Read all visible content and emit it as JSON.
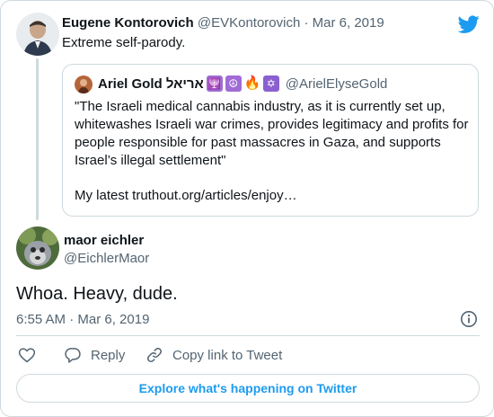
{
  "parent_tweet": {
    "author_name": "Eugene Kontorovich",
    "author_handle": "@EVKontorovich",
    "separator": "·",
    "date": "Mar 6, 2019",
    "text": "Extreme self-parody."
  },
  "quoted_tweet": {
    "author_name": "Ariel Gold אריאל",
    "emoji": [
      "🕎",
      "☮",
      "🔥",
      "✡"
    ],
    "author_handle": "@ArielElyseGold",
    "text": "\"The Israeli medical cannabis industry, as it is currently set up, whitewashes Israeli war crimes, provides legitimacy and profits for people responsible for past massacres in Gaza, and supports Israel’s illegal settlement\"",
    "link_text": "My latest truthout.org/articles/enjoy…"
  },
  "main_tweet": {
    "author_name": "maor eichler",
    "author_handle": "@EichlerMaor",
    "text": "Whoa. Heavy, dude.",
    "timestamp": "6:55 AM · Mar 6, 2019"
  },
  "actions": {
    "reply_label": "Reply",
    "copy_link_label": "Copy link to Tweet"
  },
  "explore_label": "Explore what's happening on Twitter",
  "colors": {
    "accent": "#1d9bf0",
    "text": "#0f1419",
    "muted": "#536471",
    "border": "#cfd9de"
  },
  "icons": [
    "twitter-logo-icon",
    "info-icon",
    "heart-icon",
    "reply-icon",
    "link-icon"
  ]
}
